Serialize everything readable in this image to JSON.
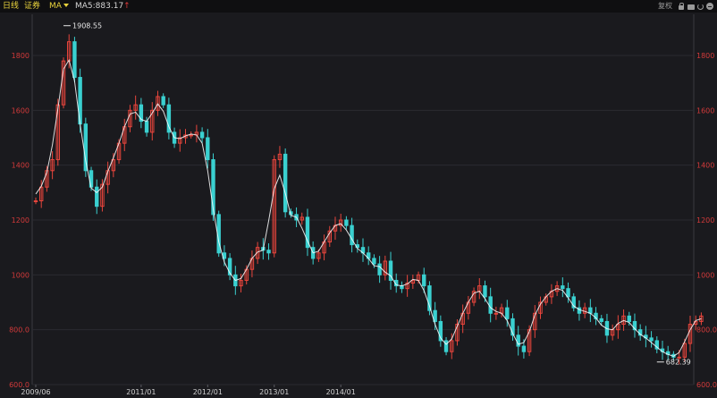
{
  "toolbar": {
    "period_label": "日线",
    "symbol_label": "证券",
    "ma_label": "MA",
    "ma5_label": "MA5:883.17",
    "ma5_arrow": "↑",
    "adjust_label": "复权",
    "icons": [
      "lock-icon",
      "camera-icon",
      "refresh-icon",
      "minimize-icon"
    ]
  },
  "colors": {
    "background": "#1a1a1e",
    "up": "#e8453c",
    "down": "#3ad0d0",
    "ma_line": "#ffffff",
    "axis_text": "#d33a3a",
    "grid": "#2b2b30"
  },
  "chart_data": {
    "type": "line",
    "ylim": [
      600,
      1950
    ],
    "y_ticks": [
      "1800",
      "1600",
      "1400",
      "1200",
      "1000",
      "800.0",
      "600.0"
    ],
    "y_tick_values": [
      1800,
      1600,
      1400,
      1200,
      1000,
      800,
      600
    ],
    "x_ticks": [
      "2009/06",
      "2011/01",
      "2012/01",
      "2013/01",
      "2014/01"
    ],
    "grid": true,
    "annotations": [
      {
        "text": "1908.55",
        "x": "2009/11",
        "y": 1908.55
      },
      {
        "text": "682.39",
        "x": "2018/10",
        "y": 682.39
      }
    ],
    "x": [
      "2009/06",
      "2009/07",
      "2009/08",
      "2009/09",
      "2009/10",
      "2009/11",
      "2009/12",
      "2010/01",
      "2010/02",
      "2010/03",
      "2010/04",
      "2010/05",
      "2010/06",
      "2010/07",
      "2010/08",
      "2010/09",
      "2010/10",
      "2010/11",
      "2010/12",
      "2011/01",
      "2011/02",
      "2011/03",
      "2011/04",
      "2011/05",
      "2011/06",
      "2011/07",
      "2011/08",
      "2011/09",
      "2011/10",
      "2011/11",
      "2011/12",
      "2012/01",
      "2012/02",
      "2012/03",
      "2012/04",
      "2012/05",
      "2012/06",
      "2012/07",
      "2012/08",
      "2012/09",
      "2012/10",
      "2012/11",
      "2012/12",
      "2013/01",
      "2013/02",
      "2013/03",
      "2013/04",
      "2013/05",
      "2013/06",
      "2013/07",
      "2013/08",
      "2013/09",
      "2013/10",
      "2013/11",
      "2013/12",
      "2014/01",
      "2014/02",
      "2014/03",
      "2014/04",
      "2014/05",
      "2014/06",
      "2014/07",
      "2014/08",
      "2014/09",
      "2014/10",
      "2014/11",
      "2014/12",
      "2015/01",
      "2015/02",
      "2015/03",
      "2015/04",
      "2015/05",
      "2015/06",
      "2015/07",
      "2015/08",
      "2015/09",
      "2015/10",
      "2015/11",
      "2015/12",
      "2016/01",
      "2016/02",
      "2016/03",
      "2016/04",
      "2016/05",
      "2016/06",
      "2016/07",
      "2016/08",
      "2016/09",
      "2016/10",
      "2016/11",
      "2016/12",
      "2017/01",
      "2017/02",
      "2017/03",
      "2017/04",
      "2017/05",
      "2017/06",
      "2017/07",
      "2017/08",
      "2017/09",
      "2017/10",
      "2017/11",
      "2017/12",
      "2018/01",
      "2018/02",
      "2018/03",
      "2018/04",
      "2018/05",
      "2018/06",
      "2018/07",
      "2018/08",
      "2018/09",
      "2018/10",
      "2018/11",
      "2018/12",
      "2019/01",
      "2019/02",
      "2019/03",
      "2019/04"
    ],
    "series": [
      {
        "values": [
          1270,
          1320,
          1380,
          1420,
          1620,
          1780,
          1850,
          1720,
          1550,
          1380,
          1320,
          1250,
          1330,
          1380,
          1420,
          1480,
          1540,
          1600,
          1620,
          1560,
          1520,
          1600,
          1650,
          1620,
          1520,
          1480,
          1500,
          1510,
          1510,
          1520,
          1500,
          1420,
          1220,
          1080,
          1060,
          1000,
          960,
          980,
          1020,
          1060,
          1100,
          1090,
          1080,
          1420,
          1440,
          1230,
          1220,
          1200,
          1210,
          1100,
          1060,
          1080,
          1120,
          1160,
          1180,
          1200,
          1180,
          1110,
          1100,
          1080,
          1060,
          1040,
          1000,
          1050,
          980,
          960,
          950,
          970,
          980,
          1000,
          960,
          870,
          830,
          760,
          720,
          760,
          820,
          860,
          900,
          940,
          960,
          920,
          860,
          860,
          880,
          840,
          780,
          740,
          720,
          800,
          860,
          900,
          920,
          940,
          960,
          950,
          920,
          880,
          860,
          880,
          860,
          840,
          830,
          780,
          800,
          820,
          850,
          830,
          800,
          780,
          770,
          760,
          730,
          720,
          710,
          700,
          700,
          750,
          820,
          830,
          850
        ]
      }
    ]
  }
}
